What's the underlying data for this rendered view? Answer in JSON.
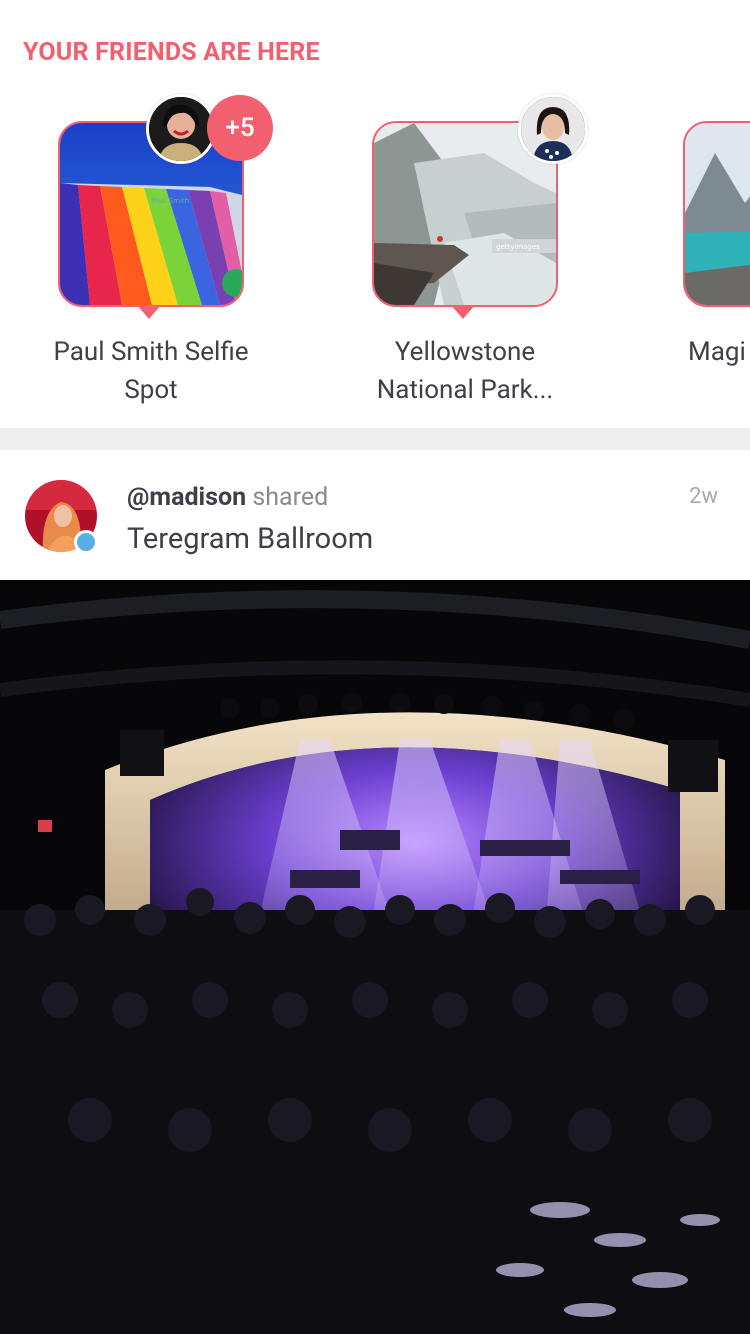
{
  "friends_section": {
    "title": "YOUR FRIENDS ARE HERE",
    "places": [
      {
        "label_line1": "Paul Smith Selfie",
        "label_line2": "Spot",
        "extra_friends": "+5"
      },
      {
        "label_line1": "Yellowstone",
        "label_line2": "National Park..."
      },
      {
        "label_line1": "Magi",
        "label_line2": ""
      }
    ]
  },
  "post": {
    "username": "@madison",
    "verb": "shared",
    "place": "Teregram Ballroom",
    "time": "2w"
  },
  "colors": {
    "accent": "#f25f6e",
    "title": "#f25f6e",
    "online": "#5aaee6",
    "text": "#3f3f4a"
  }
}
